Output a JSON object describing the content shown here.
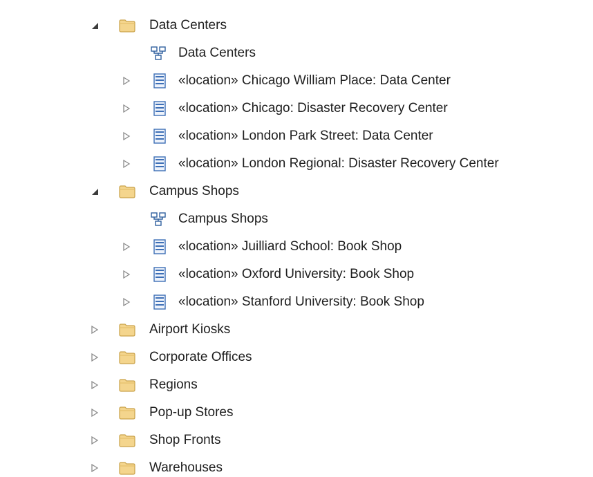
{
  "tree": {
    "groups": [
      {
        "label": "Data Centers",
        "expanded": true,
        "diagram": "Data Centers",
        "children": [
          {
            "stereotype": "«location»",
            "name": "Chicago William Place: Data Center"
          },
          {
            "stereotype": "«location»",
            "name": "Chicago: Disaster Recovery Center"
          },
          {
            "stereotype": "«location»",
            "name": "London Park Street: Data Center"
          },
          {
            "stereotype": "«location»",
            "name": "London Regional: Disaster Recovery Center"
          }
        ]
      },
      {
        "label": "Campus Shops",
        "expanded": true,
        "diagram": "Campus Shops",
        "children": [
          {
            "stereotype": "«location»",
            "name": "Juilliard School: Book Shop"
          },
          {
            "stereotype": "«location»",
            "name": "Oxford University: Book Shop"
          },
          {
            "stereotype": "«location»",
            "name": "Stanford University: Book Shop"
          }
        ]
      }
    ],
    "collapsed_folders": [
      "Airport Kiosks",
      "Corporate Offices",
      "Regions",
      "Pop-up Stores",
      "Shop Fronts",
      "Warehouses"
    ]
  },
  "icons": {
    "expanded": "expanded-triangle-icon",
    "collapsed": "collapsed-triangle-icon",
    "folder": "folder-icon",
    "diagram": "diagram-icon",
    "element": "location-element-icon"
  },
  "colors": {
    "folder_fill": "#f4d58d",
    "folder_stroke": "#c9a24a",
    "element_blue": "#3d6fb6",
    "toggle_dark": "#3c3c3c",
    "toggle_light": "#8a8a8a"
  }
}
